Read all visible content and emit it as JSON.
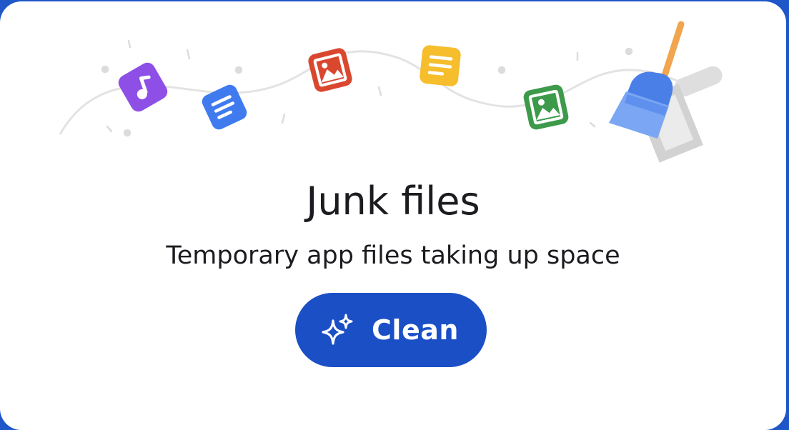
{
  "card": {
    "title": "Junk files",
    "subtitle": "Temporary app files taking up space",
    "clean_button": {
      "label": "Clean",
      "icon": "sparkle-icon"
    }
  },
  "illustration": {
    "icons": [
      "audio-file-icon",
      "doc-file-icon",
      "image-file-icon",
      "notes-file-icon",
      "image-file-icon",
      "broom-icon",
      "dustpan-icon"
    ]
  },
  "colors": {
    "accent": "#1b4fc6",
    "background_edge": "#1f57c8",
    "card": "#ffffff",
    "text": "#1c1b1f"
  }
}
